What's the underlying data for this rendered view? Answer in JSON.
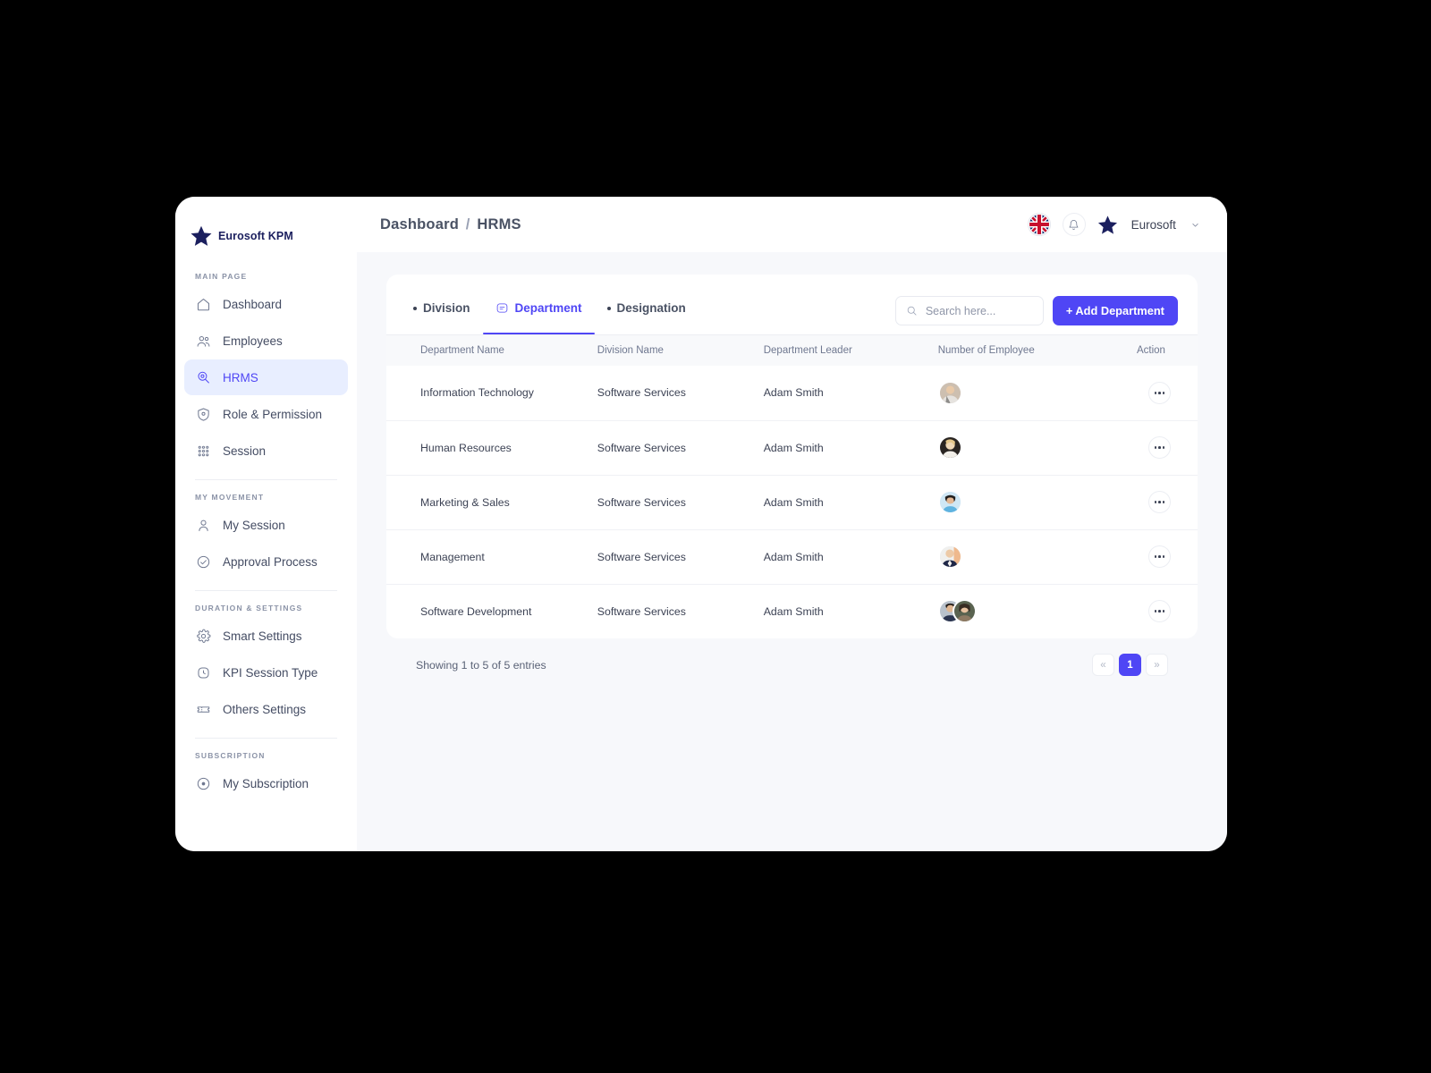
{
  "brand": {
    "name": "Eurosoft KPM",
    "icon": "star-icon"
  },
  "sidebar": {
    "groups": [
      {
        "label": "MAIN PAGE",
        "items": [
          {
            "label": "Dashboard",
            "icon": "home-icon",
            "active": false
          },
          {
            "label": "Employees",
            "icon": "users-icon",
            "active": false
          },
          {
            "label": "HRMS",
            "icon": "hrms-badge-icon",
            "active": true
          },
          {
            "label": "Role & Permission",
            "icon": "shield-icon",
            "active": false
          },
          {
            "label": "Session",
            "icon": "grid-dots-icon",
            "active": false
          }
        ]
      },
      {
        "label": "MY MOVEMENT",
        "items": [
          {
            "label": "My Session",
            "icon": "user-icon",
            "active": false
          },
          {
            "label": "Approval Process",
            "icon": "check-circle-icon",
            "active": false
          }
        ]
      },
      {
        "label": "DURATION & SETTINGS",
        "items": [
          {
            "label": "Smart Settings",
            "icon": "gear-icon",
            "active": false
          },
          {
            "label": "KPI Session Type",
            "icon": "clock-icon",
            "active": false
          },
          {
            "label": "Others Settings",
            "icon": "ticket-icon",
            "active": false
          }
        ]
      },
      {
        "label": "SUBSCRIPTION",
        "items": [
          {
            "label": "My Subscription",
            "icon": "coin-icon",
            "active": false
          }
        ]
      }
    ]
  },
  "topbar": {
    "breadcrumb": {
      "root": "Dashboard",
      "separator": "/",
      "current": "HRMS"
    },
    "language_flag": "uk-flag-icon",
    "notification_icon": "bell-icon",
    "user": {
      "name": "Eurosoft",
      "avatar_icon": "star-icon",
      "chevron": "chevron-down-icon"
    }
  },
  "card": {
    "tabs": [
      {
        "label": "Division",
        "icon": "dot-icon",
        "active": false
      },
      {
        "label": "Department",
        "icon": "department-icon",
        "active": true
      },
      {
        "label": "Designation",
        "icon": "dot-icon",
        "active": false
      }
    ],
    "search": {
      "placeholder": "Search here...",
      "value": "",
      "icon": "search-icon"
    },
    "add_button": {
      "label": "+ Add Department"
    }
  },
  "table": {
    "columns": [
      "Department Name",
      "Division Name",
      "Department Leader",
      "Number of Employee",
      "Action"
    ],
    "rows": [
      {
        "department": "Information Technology",
        "division": "Software Services",
        "leader": "Adam Smith",
        "employee_avatars": 1
      },
      {
        "department": "Human Resources",
        "division": "Software Services",
        "leader": "Adam Smith",
        "employee_avatars": 1
      },
      {
        "department": "Marketing & Sales",
        "division": "Software Services",
        "leader": "Adam Smith",
        "employee_avatars": 1
      },
      {
        "department": "Management",
        "division": "Software Services",
        "leader": "Adam Smith",
        "employee_avatars": 1
      },
      {
        "department": "Software Development",
        "division": "Software Services",
        "leader": "Adam Smith",
        "employee_avatars": 2
      }
    ]
  },
  "footer": {
    "entries_text": "Showing 1 to 5 of 5 entries",
    "pagination": {
      "prev": "«",
      "pages": [
        "1"
      ],
      "next": "»",
      "active_page": "1"
    }
  },
  "colors": {
    "accent": "#4f46f5",
    "brand_navy": "#1b1f5e",
    "page_bg": "#f7f8fb",
    "card_bg": "#ffffff",
    "text": "#3c4254",
    "muted": "#6f7890"
  }
}
